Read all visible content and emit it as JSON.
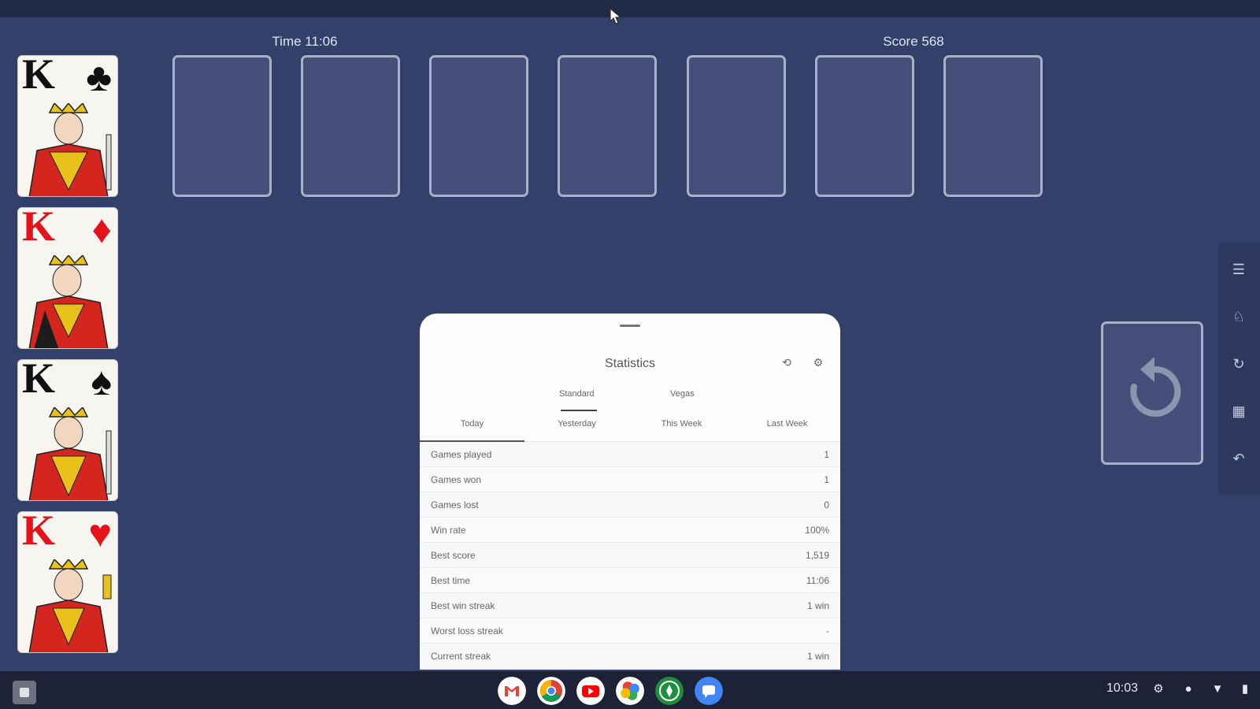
{
  "hud": {
    "time": "Time 11:06",
    "score": "Score 568"
  },
  "foundations": [
    {
      "rank": "K",
      "suit": "♣",
      "color": "black"
    },
    {
      "rank": "K",
      "suit": "♦",
      "color": "red"
    },
    {
      "rank": "K",
      "suit": "♠",
      "color": "black"
    },
    {
      "rank": "K",
      "suit": "♥",
      "color": "red"
    }
  ],
  "statistics": {
    "title": "Statistics",
    "modes": [
      "Standard",
      "Vegas"
    ],
    "periods": [
      "Today",
      "Yesterday",
      "This Week",
      "Last Week"
    ],
    "rows": [
      {
        "label": "Games played",
        "value": "1"
      },
      {
        "label": "Games won",
        "value": "1"
      },
      {
        "label": "Games lost",
        "value": "0"
      },
      {
        "label": "Win rate",
        "value": "100%"
      },
      {
        "label": "Best score",
        "value": "1,519"
      },
      {
        "label": "Best time",
        "value": "11:06"
      },
      {
        "label": "Best win streak",
        "value": "1 win"
      },
      {
        "label": "Worst loss streak",
        "value": "-"
      },
      {
        "label": "Current streak",
        "value": "1 win"
      }
    ]
  },
  "shelf": {
    "time": "10:03"
  },
  "colors": {
    "felt": "#33406a",
    "slot_border": "#a9b1c6",
    "sheet": "#fdfdfe",
    "taskbar": "#1d2236"
  }
}
